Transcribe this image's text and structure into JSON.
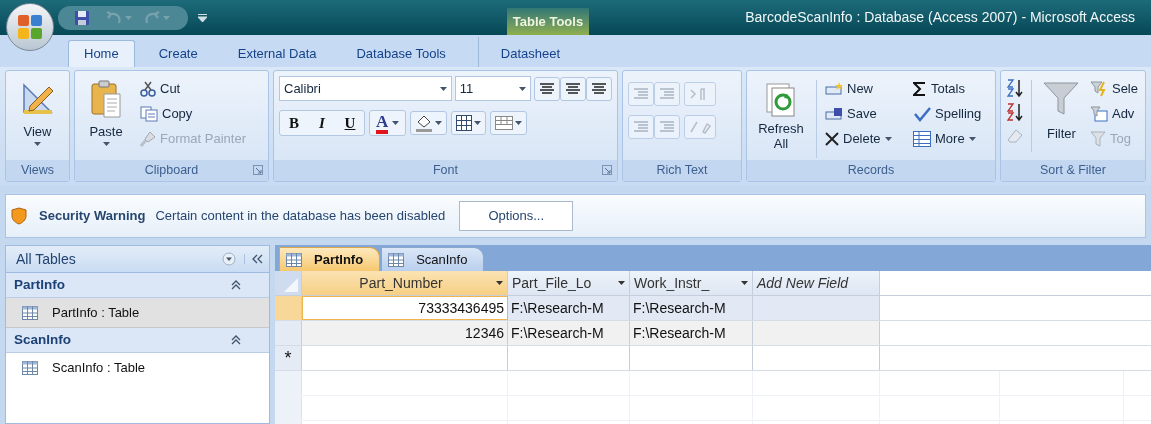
{
  "title_bar": {
    "contextual_tab": "Table Tools",
    "title": "BarcodeScanInfo : Database (Access 2007) - Microsoft Access"
  },
  "ribbon_tabs": [
    {
      "label": "Home",
      "selected": true
    },
    {
      "label": "Create",
      "selected": false
    },
    {
      "label": "External Data",
      "selected": false
    },
    {
      "label": "Database Tools",
      "selected": false
    },
    {
      "label": "Datasheet",
      "selected": false
    }
  ],
  "ribbon": {
    "views": {
      "label": "Views",
      "view": "View"
    },
    "clipboard": {
      "label": "Clipboard",
      "paste": "Paste",
      "cut": "Cut",
      "copy": "Copy",
      "format_painter": {
        "label": "Format Painter",
        "disabled": true
      }
    },
    "font": {
      "label": "Font",
      "font_name": "Calibri",
      "font_size": "11",
      "bold": "B",
      "italic": "I",
      "underline": "U",
      "font_color": "A"
    },
    "rich_text": {
      "label": "Rich Text"
    },
    "records": {
      "label": "Records",
      "refresh": "Refresh All",
      "new": "New",
      "save": "Save",
      "delete": "Delete",
      "totals": "Totals",
      "spelling": "Spelling",
      "more": "More"
    },
    "sort_filter": {
      "label": "Sort & Filter",
      "filter": "Filter",
      "selection": "Sele",
      "advanced": "Adv",
      "toggle": {
        "label": "Tog",
        "disabled": true
      }
    }
  },
  "security_bar": {
    "title": "Security Warning",
    "message": "Certain content in the database has been disabled",
    "button": "Options..."
  },
  "nav_pane": {
    "title": "All Tables",
    "groups": [
      {
        "label": "PartInfo",
        "expanded": true,
        "children": [
          {
            "label": "PartInfo : Table",
            "selected": true
          }
        ]
      },
      {
        "label": "ScanInfo",
        "expanded": true,
        "children": [
          {
            "label": "ScanInfo : Table",
            "selected": false
          }
        ]
      }
    ]
  },
  "doc_tabs": [
    {
      "label": "PartInfo",
      "selected": true
    },
    {
      "label": "ScanInfo",
      "selected": false
    }
  ],
  "datasheet": {
    "columns": [
      {
        "label": "Part_Number",
        "kind": "field",
        "selected": true
      },
      {
        "label": "Part_File_Lo",
        "kind": "field",
        "selected": false
      },
      {
        "label": "Work_Instr_",
        "kind": "field",
        "selected": false
      },
      {
        "label": "Add New Field",
        "kind": "add_field",
        "selected": false
      }
    ],
    "rows": [
      {
        "kind": "record",
        "selected": true,
        "cells": [
          "73333436495",
          "F:\\Research-M",
          "F:\\Research-M"
        ]
      },
      {
        "kind": "record",
        "selected": false,
        "cells": [
          "12346",
          "F:\\Research-M",
          "F:\\Research-M"
        ]
      },
      {
        "kind": "new",
        "selected": false,
        "selector": "*"
      }
    ]
  }
}
